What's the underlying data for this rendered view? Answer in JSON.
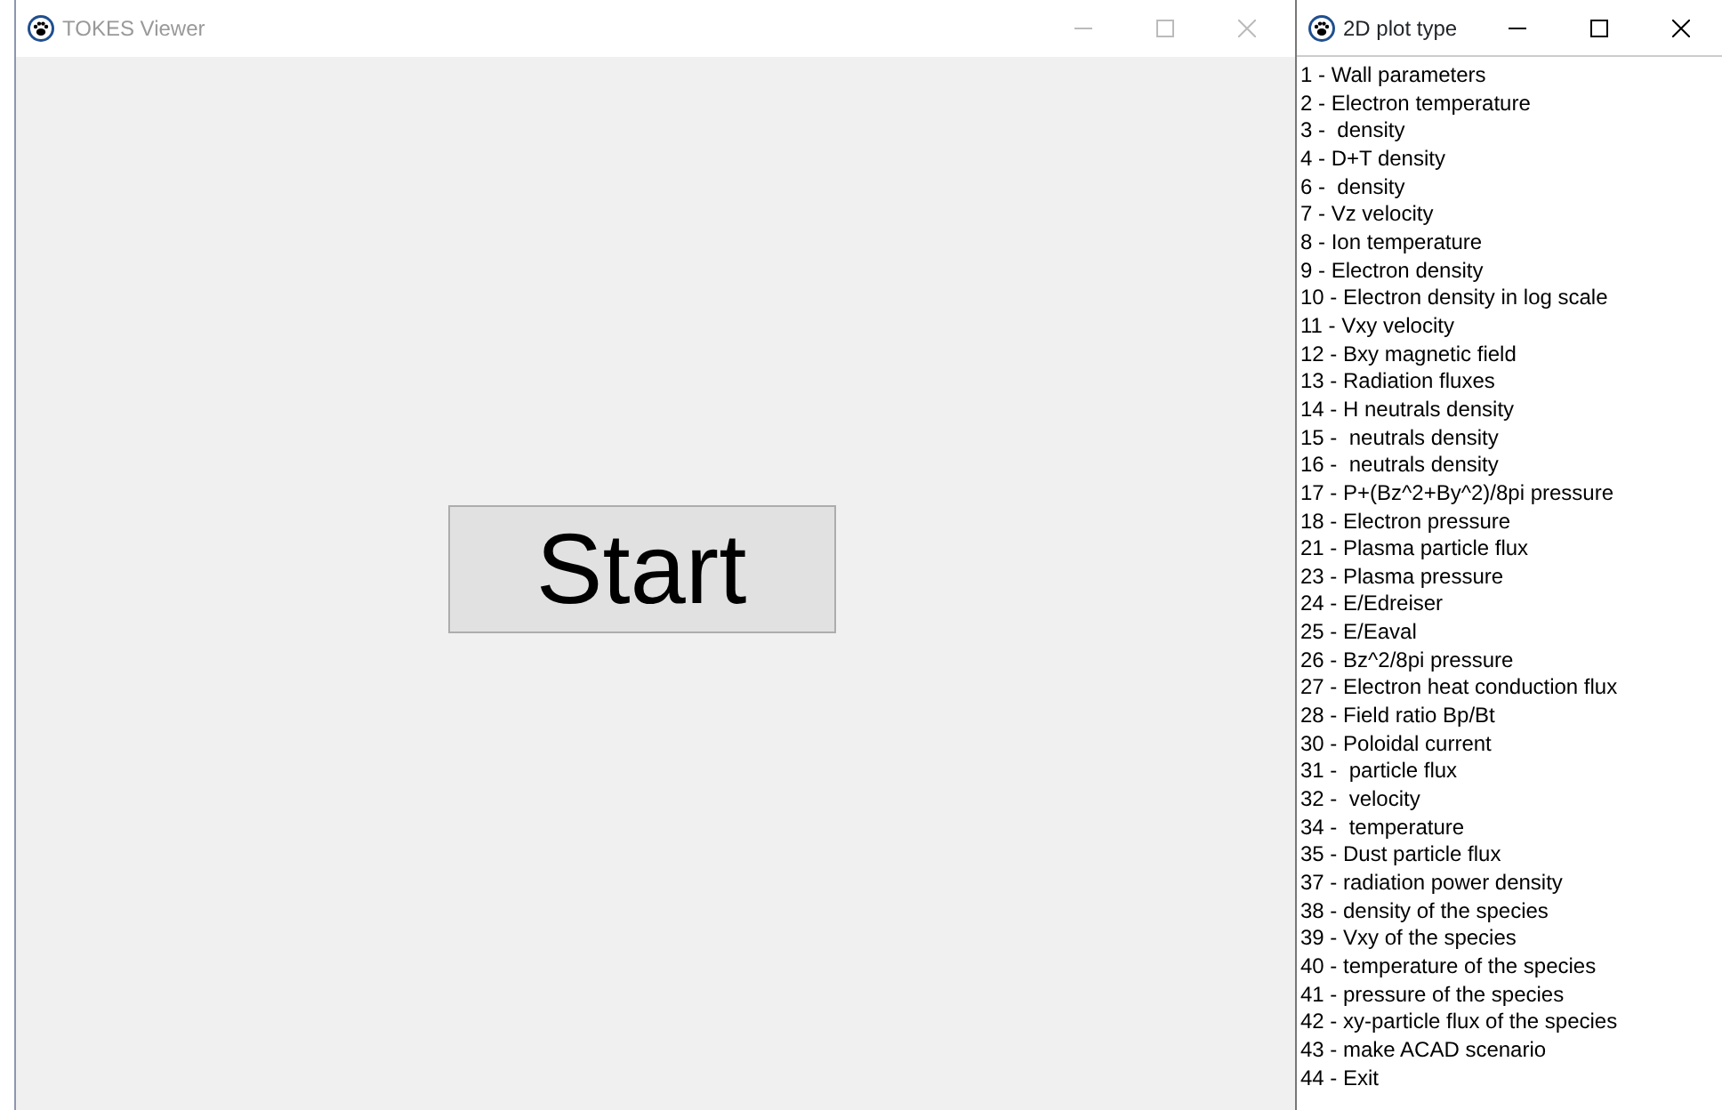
{
  "main_window": {
    "title": "TOKES Viewer",
    "start_button": "Start"
  },
  "plot_window": {
    "title": "2D plot type",
    "items": [
      "1 - Wall parameters",
      "2 - Electron temperature",
      "3 -  density",
      "4 - D+T density",
      "6 -  density",
      "7 - Vz velocity",
      "8 - Ion temperature",
      "9 - Electron density",
      "10 - Electron density in log scale",
      "11 - Vxy velocity",
      "12 - Bxy magnetic field",
      "13 - Radiation fluxes",
      "14 - H neutrals density",
      "15 -  neutrals density",
      "16 -  neutrals density",
      "17 - P+(Bz^2+By^2)/8pi pressure",
      "18 - Electron pressure",
      "21 - Plasma particle flux",
      "23 - Plasma pressure",
      "24 - E/Edreiser",
      "25 - E/Eaval",
      "26 - Bz^2/8pi pressure",
      "27 - Electron heat conduction flux",
      "28 - Field ratio Bp/Bt",
      "30 - Poloidal current",
      "31 -  particle flux",
      "32 -  velocity",
      "34 -  temperature",
      "35 - Dust particle flux",
      "37 - radiation power density",
      "38 - density of the species",
      "39 - Vxy of the species",
      "40 - temperature of the species",
      "41 - pressure of the species",
      "42 - xy-particle flux of the species",
      "43 - make ACAD scenario",
      "44 - Exit"
    ]
  }
}
